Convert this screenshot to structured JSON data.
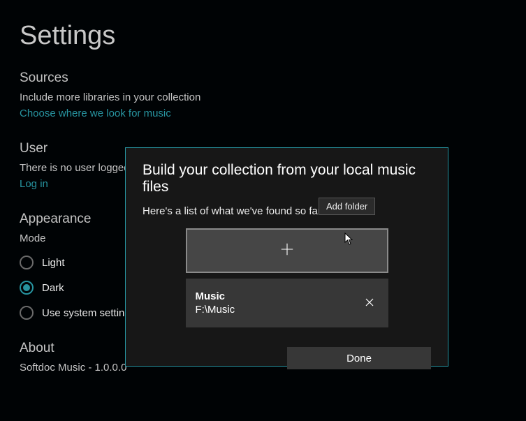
{
  "page_title": "Settings",
  "sources": {
    "heading": "Sources",
    "subtitle": "Include more libraries in your collection",
    "link": "Choose where we look for music"
  },
  "user": {
    "heading": "User",
    "status": "There is no user logged in.",
    "login_link": "Log in"
  },
  "appearance": {
    "heading": "Appearance",
    "mode_label": "Mode",
    "options": {
      "light": "Light",
      "dark": "Dark",
      "system": "Use system settings"
    },
    "selected": "dark"
  },
  "about": {
    "heading": "About",
    "version_line": "Softdoc Music - 1.0.0.0"
  },
  "dialog": {
    "title": "Build your collection from your local music files",
    "subtitle": "Here's a list of what we've found so far.",
    "add_tooltip": "Add folder",
    "folders": [
      {
        "name": "Music",
        "path": "F:\\Music"
      }
    ],
    "done_label": "Done"
  },
  "colors": {
    "accent": "#2794a0",
    "dialog_bg": "#171717",
    "panel_bg": "#373737",
    "add_bg": "#464646"
  }
}
